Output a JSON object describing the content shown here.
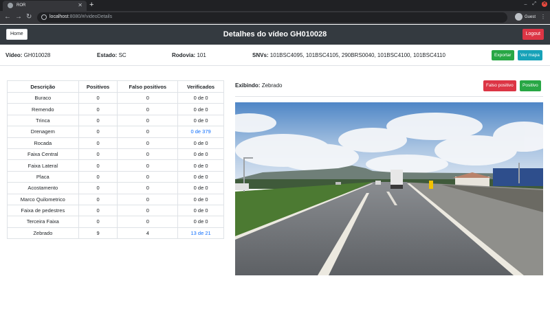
{
  "browser": {
    "tab_title": "ROR",
    "new_tab": "+",
    "url_host": "localhost",
    "url_rest": ":8080/#/videoDetails",
    "profile_name": "Guest"
  },
  "navbar": {
    "home_label": "Home",
    "title": "Detalhes do vídeo GH010028",
    "logout_label": "Logout"
  },
  "info": {
    "video_label": "Vídeo:",
    "video_value": "GH010028",
    "estado_label": "Estado:",
    "estado_value": "SC",
    "rodovia_label": "Rodovia:",
    "rodovia_value": "101",
    "snvs_label": "SNVs:",
    "snvs_value": "101BSC4095, 101BSC4105, 290BRS0040, 101BSC4100, 101BSC4110",
    "exportar_label": "Exportar",
    "vermapa_label": "Ver mapa"
  },
  "table": {
    "headers": [
      "Descrição",
      "Positivos",
      "Falso positivos",
      "Verificados"
    ],
    "rows": [
      {
        "desc": "Buraco",
        "pos": "0",
        "fp": "0",
        "ver": "0 de 0",
        "link": false
      },
      {
        "desc": "Remendo",
        "pos": "0",
        "fp": "0",
        "ver": "0 de 0",
        "link": false
      },
      {
        "desc": "Trinca",
        "pos": "0",
        "fp": "0",
        "ver": "0 de 0",
        "link": false
      },
      {
        "desc": "Drenagem",
        "pos": "0",
        "fp": "0",
        "ver": "0 de 379",
        "link": true
      },
      {
        "desc": "Rocada",
        "pos": "0",
        "fp": "0",
        "ver": "0 de 0",
        "link": false
      },
      {
        "desc": "Faixa Central",
        "pos": "0",
        "fp": "0",
        "ver": "0 de 0",
        "link": false
      },
      {
        "desc": "Faixa Lateral",
        "pos": "0",
        "fp": "0",
        "ver": "0 de 0",
        "link": false
      },
      {
        "desc": "Placa",
        "pos": "0",
        "fp": "0",
        "ver": "0 de 0",
        "link": false
      },
      {
        "desc": "Acostamento",
        "pos": "0",
        "fp": "0",
        "ver": "0 de 0",
        "link": false
      },
      {
        "desc": "Marco Quilometrico",
        "pos": "0",
        "fp": "0",
        "ver": "0 de 0",
        "link": false
      },
      {
        "desc": "Faixa de pedestres",
        "pos": "0",
        "fp": "0",
        "ver": "0 de 0",
        "link": false
      },
      {
        "desc": "Terceira Faixa",
        "pos": "0",
        "fp": "0",
        "ver": "0 de 0",
        "link": false
      },
      {
        "desc": "Zebrado",
        "pos": "9",
        "fp": "4",
        "ver": "13 de 21",
        "link": true
      }
    ]
  },
  "viewer": {
    "exibindo_label": "Exibindo:",
    "exibindo_value": "Zebrado",
    "falso_positivo_label": "Falso positivo",
    "positivo_label": "Positivo"
  },
  "colors": {
    "navbar": "#343a40",
    "danger": "#dc3545",
    "success": "#28a745",
    "info": "#17a2b8",
    "link": "#0d6efd"
  }
}
